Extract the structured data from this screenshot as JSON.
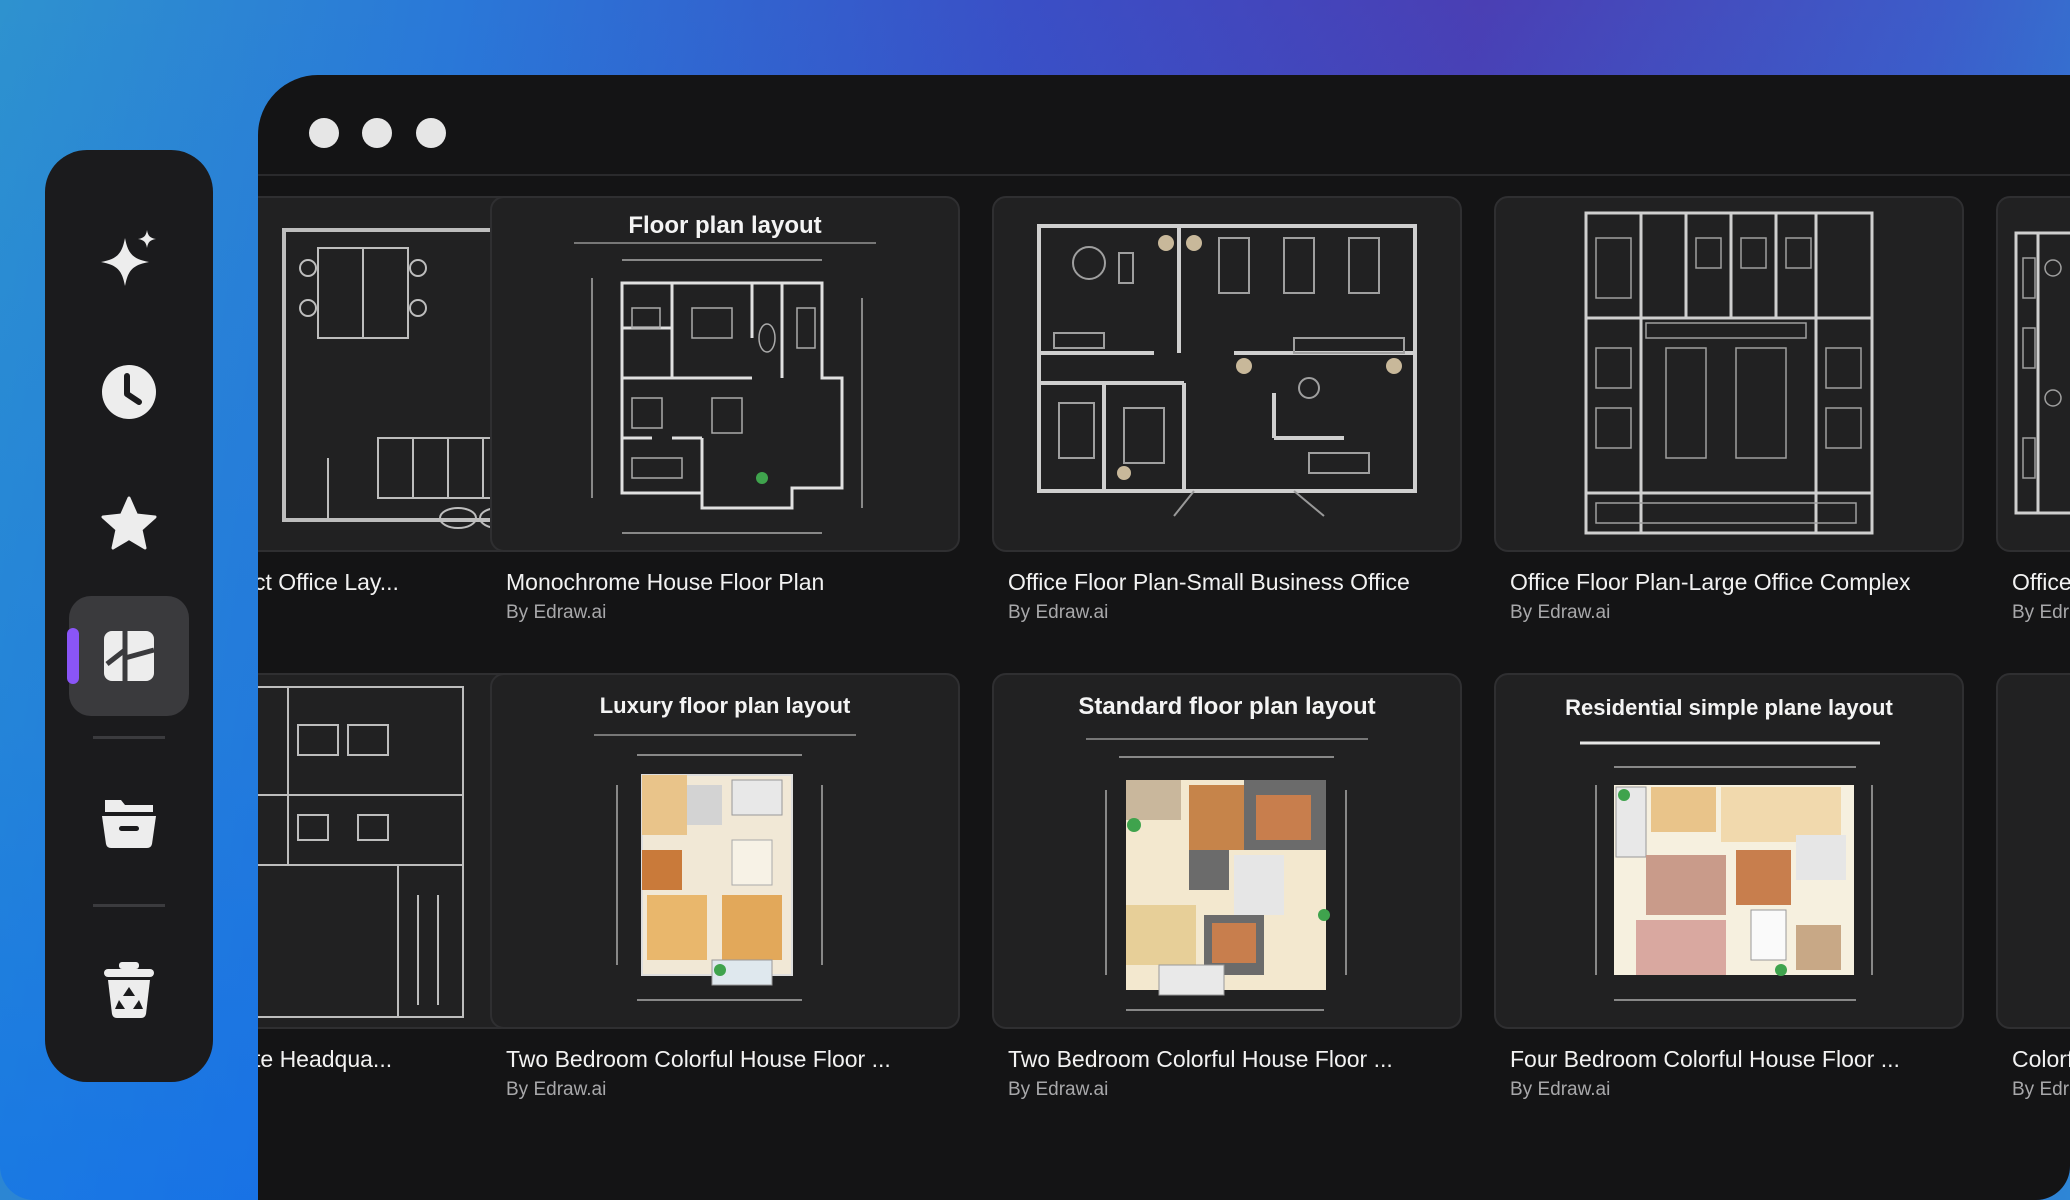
{
  "window": {
    "controls": [
      "close",
      "minimize",
      "maximize"
    ]
  },
  "sidebar": {
    "items": [
      {
        "name": "ai-sparkle",
        "icon": "sparkle-icon",
        "active": false
      },
      {
        "name": "recent",
        "icon": "clock-icon",
        "active": false
      },
      {
        "name": "favorites",
        "icon": "star-icon",
        "active": false
      },
      {
        "name": "templates",
        "icon": "template-icon",
        "active": true
      },
      {
        "name": "files",
        "icon": "folder-icon",
        "active": false
      },
      {
        "name": "recycle-bin",
        "icon": "recycle-bin-icon",
        "active": false
      }
    ],
    "accent_color": "#8a55f7"
  },
  "templates": {
    "row1": [
      {
        "title": "ct Office Lay...",
        "author": ""
      },
      {
        "title": "Monochrome House Floor Plan",
        "author": "By Edraw.ai",
        "thumb_heading": "Floor plan layout"
      },
      {
        "title": "Office Floor Plan-Small Business Office",
        "author": "By Edraw.ai"
      },
      {
        "title": "Office Floor Plan-Large Office Complex",
        "author": "By Edraw.ai"
      },
      {
        "title": "Office",
        "author": "By Edr"
      }
    ],
    "row2": [
      {
        "title": "te Headqua...",
        "author": ""
      },
      {
        "title": "Two Bedroom Colorful House Floor ...",
        "author": "By Edraw.ai",
        "thumb_heading": "Luxury floor plan layout"
      },
      {
        "title": "Two Bedroom Colorful House Floor ...",
        "author": "By Edraw.ai",
        "thumb_heading": "Standard floor plan layout"
      },
      {
        "title": "Four Bedroom Colorful House Floor ...",
        "author": "By Edraw.ai",
        "thumb_heading": "Residential simple plane layout"
      },
      {
        "title": "Colorf",
        "author": "By Edr"
      }
    ]
  }
}
